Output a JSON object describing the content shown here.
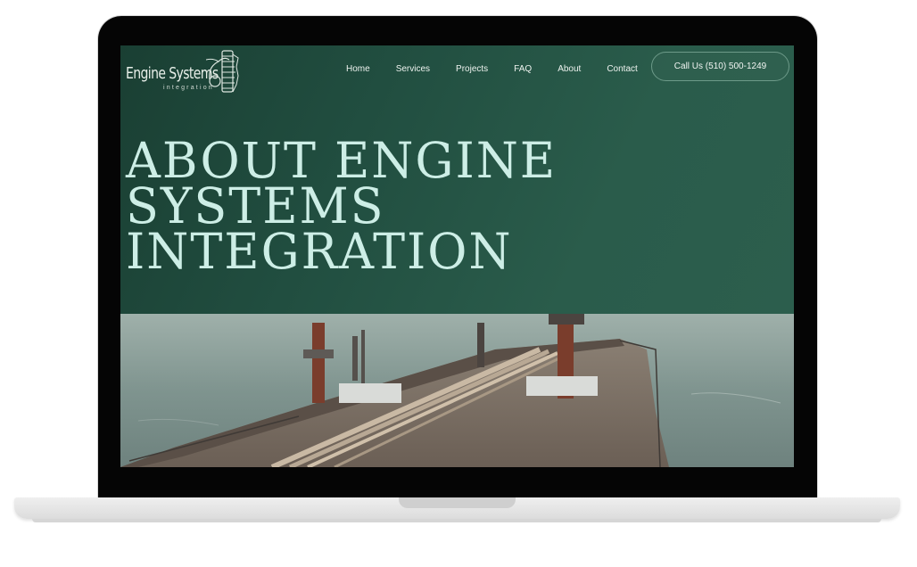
{
  "brand": {
    "name": "Engine Systems",
    "tagline": "integration"
  },
  "nav": {
    "items": [
      {
        "label": "Home"
      },
      {
        "label": "Services"
      },
      {
        "label": "Projects"
      },
      {
        "label": "FAQ"
      },
      {
        "label": "About"
      },
      {
        "label": "Contact"
      }
    ],
    "cta_label": "Call Us  (510) 500-1249"
  },
  "hero": {
    "title_lines": [
      "ABOUT ENGINE",
      "SYSTEMS",
      "INTEGRATION"
    ]
  },
  "colors": {
    "hero_bg": "#214e40",
    "headline": "#cdeee6",
    "button_border": "#6d9a89"
  },
  "icons": {
    "logo_mark": "engine-gear-icon"
  }
}
